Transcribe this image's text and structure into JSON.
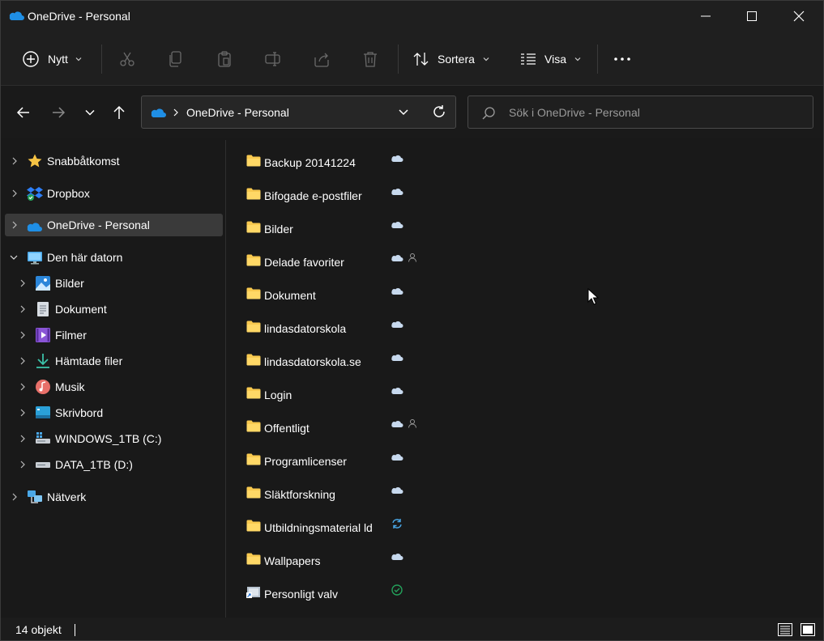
{
  "window": {
    "title": "OneDrive - Personal",
    "colors": {
      "bg": "#191919",
      "folder": "#f8c94f",
      "cloud": "#c7d9ee",
      "accent": "#1f8fe6",
      "synced": "#23a05a"
    }
  },
  "toolbar": {
    "new_label": "Nytt",
    "sort_label": "Sortera",
    "view_label": "Visa",
    "icons": [
      "cut-icon",
      "copy-icon",
      "paste-icon",
      "rename-icon",
      "share-icon",
      "delete-icon",
      "more-icon"
    ]
  },
  "address": {
    "path": "OneDrive - Personal",
    "search_placeholder": "Sök i OneDrive - Personal"
  },
  "sidebar": {
    "items": [
      {
        "label": "Snabbåtkomst",
        "icon": "star-icon",
        "level": 0,
        "expanded": false
      },
      {
        "label": "Dropbox",
        "icon": "dropbox-icon",
        "level": 0,
        "expanded": false
      },
      {
        "label": "OneDrive - Personal",
        "icon": "onedrive-icon",
        "level": 0,
        "expanded": false,
        "selected": true
      },
      {
        "label": "Den här datorn",
        "icon": "computer-icon",
        "level": 0,
        "expanded": true
      },
      {
        "label": "Bilder",
        "icon": "pictures-icon",
        "level": 1
      },
      {
        "label": "Dokument",
        "icon": "documents-icon",
        "level": 1
      },
      {
        "label": "Filmer",
        "icon": "videos-icon",
        "level": 1
      },
      {
        "label": "Hämtade filer",
        "icon": "downloads-icon",
        "level": 1
      },
      {
        "label": "Musik",
        "icon": "music-icon",
        "level": 1
      },
      {
        "label": "Skrivbord",
        "icon": "desktop-icon",
        "level": 1
      },
      {
        "label": "WINDOWS_1TB (C:)",
        "icon": "windows-drive-icon",
        "level": 1
      },
      {
        "label": "DATA_1TB (D:)",
        "icon": "drive-icon",
        "level": 1
      },
      {
        "label": "Nätverk",
        "icon": "network-icon",
        "level": 0,
        "expanded": false
      }
    ]
  },
  "files": [
    {
      "name": "Backup 20141224",
      "type": "folder",
      "status": "cloud",
      "shared": false
    },
    {
      "name": "Bifogade e-postfiler",
      "type": "folder",
      "status": "cloud",
      "shared": false
    },
    {
      "name": "Bilder",
      "type": "folder",
      "status": "cloud",
      "shared": false
    },
    {
      "name": "Delade favoriter",
      "type": "folder",
      "status": "cloud",
      "shared": true
    },
    {
      "name": "Dokument",
      "type": "folder",
      "status": "cloud",
      "shared": false
    },
    {
      "name": "lindasdatorskola",
      "type": "folder",
      "status": "cloud",
      "shared": false
    },
    {
      "name": "lindasdatorskola.se",
      "type": "folder",
      "status": "cloud",
      "shared": false
    },
    {
      "name": "Login",
      "type": "folder",
      "status": "cloud",
      "shared": false
    },
    {
      "name": "Offentligt",
      "type": "folder",
      "status": "cloud",
      "shared": true
    },
    {
      "name": "Programlicenser",
      "type": "folder",
      "status": "cloud",
      "shared": false
    },
    {
      "name": "Släktforskning",
      "type": "folder",
      "status": "cloud",
      "shared": false
    },
    {
      "name": "Utbildningsmaterial ld",
      "type": "folder",
      "status": "syncing",
      "shared": false
    },
    {
      "name": "Wallpapers",
      "type": "folder",
      "status": "cloud",
      "shared": false
    },
    {
      "name": "Personligt valv",
      "type": "shortcut",
      "status": "available",
      "shared": false
    }
  ],
  "statusbar": {
    "count": "14 objekt"
  }
}
